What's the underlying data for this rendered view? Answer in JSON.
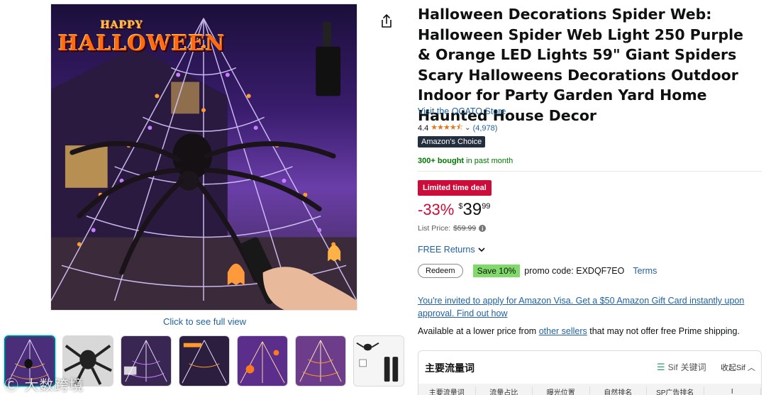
{
  "product": {
    "title": "Halloween Decorations Spider Web: Halloween Spider Web Light 250 Purple & Orange LED Lights 59\" Giant Spiders Scary Halloweens Decorations Outdoor Indoor for Party Garden Yard Home Haunted House Decor",
    "store_link": "Visit the OCATO Store",
    "rating": "4.4",
    "review_count": "(4,978)",
    "badge": "Amazon's Choice",
    "bought_bold": "300+ bought",
    "bought_rest": " in past month",
    "deal_badge": "Limited time deal",
    "discount": "-33%",
    "price_symbol": "$",
    "price_whole": "39",
    "price_fraction": "99",
    "list_price_label": "List Price:",
    "list_price": "$59.99",
    "free_returns": "FREE Returns",
    "redeem_label": "Redeem",
    "save_label": "Save 10%",
    "promo_text": "promo code: EXDQF7EO",
    "terms_label": "Terms",
    "visa_offer": "You're invited to apply for Amazon Visa. Get a $50 Amazon Gift Card instantly upon approval. Find out how",
    "lower_price_pre": "Available at a lower price from ",
    "lower_price_link": "other sellers",
    "lower_price_post": " that may not offer free Prime shipping."
  },
  "gallery": {
    "image_overlay_happy": "HAPPY",
    "image_overlay_text": "HALLOWEEN",
    "click_full_view": "Click to see full view",
    "thumbnail_count": 7
  },
  "sif_panel": {
    "title": "主要流量词",
    "keywords_logo": "Sif",
    "keywords_label": "关键词",
    "collapse_label": "收起Sif",
    "table_headers": [
      "主要流量词",
      "流量占比",
      "曝光位置",
      "自然排名",
      "SP广告排名",
      "I"
    ]
  },
  "watermark": "Ⓒ 大数跨境",
  "colors": {
    "link": "#2162a1",
    "deal": "#cc0c39",
    "star": "#de7921",
    "choice_badge": "#232f3e",
    "save_badge": "#7fda69",
    "bought": "#007600"
  }
}
